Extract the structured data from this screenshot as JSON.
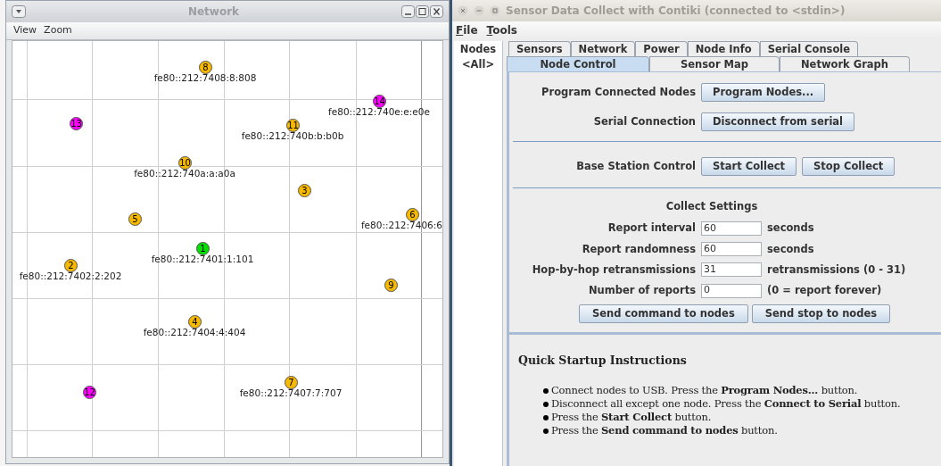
{
  "network_window": {
    "title": "Network",
    "menu": [
      "View",
      "Zoom"
    ],
    "nodes": [
      {
        "label": "8",
        "address": "fe80::212:7408:8:808",
        "color": "#f7b900"
      },
      {
        "label": "14",
        "address": "fe80::212:740e:e:e0e",
        "color": "#ff00ff"
      },
      {
        "label": "13",
        "color": "#ff00ff"
      },
      {
        "label": "11",
        "address": "fe80::212:740b:b:b0b",
        "color": "#f7b900"
      },
      {
        "label": "10",
        "address": "fe80::212:740a:a:a0a",
        "color": "#f7b900"
      },
      {
        "label": "3",
        "color": "#f7b900"
      },
      {
        "label": "5",
        "color": "#f7b900"
      },
      {
        "label": "6",
        "address": "fe80::212:7406:6",
        "color": "#f7b900"
      },
      {
        "label": "1",
        "address": "fe80::212:7401:1:101",
        "color": "#00e000"
      },
      {
        "label": "2",
        "address": "fe80::212:7402:2:202",
        "color": "#f7b900"
      },
      {
        "label": "9",
        "color": "#f7b900"
      },
      {
        "label": "4",
        "address": "fe80::212:7404:4:404",
        "color": "#f7b900"
      },
      {
        "label": "12",
        "color": "#ff00ff"
      },
      {
        "label": "7",
        "address": "fe80::212:7407:7:707",
        "color": "#f7b900"
      }
    ]
  },
  "main_window": {
    "title": "Sensor Data Collect with Contiki (connected to <stdin>)",
    "menu": [
      {
        "mnemonic": "F",
        "rest": "ile"
      },
      {
        "mnemonic": "T",
        "rest": "ools"
      }
    ],
    "nodes_list": {
      "title": "Nodes",
      "items": [
        "<All>"
      ]
    },
    "tabs_row_1": [
      {
        "label": "Sensors",
        "selected": false
      },
      {
        "label": "Network",
        "selected": false
      },
      {
        "label": "Power",
        "selected": false
      },
      {
        "label": "Node Info",
        "selected": false
      },
      {
        "label": "Serial Console",
        "selected": false
      }
    ],
    "tabs_row_2": [
      {
        "label": "Node Control",
        "selected": true
      },
      {
        "label": "Sensor Map",
        "selected": false
      },
      {
        "label": "Network Graph",
        "selected": false
      }
    ],
    "node_control": {
      "program_row": {
        "label": "Program Connected Nodes",
        "buttons": [
          "Program Nodes..."
        ]
      },
      "serial_row": {
        "label": "Serial Connection",
        "buttons": [
          "Disconnect from serial"
        ]
      },
      "base_station_row": {
        "label": "Base Station Control",
        "buttons": [
          "Start Collect",
          "Stop Collect"
        ]
      },
      "collect_settings": {
        "title": "Collect Settings",
        "fields": [
          {
            "label": "Report interval",
            "value": "60",
            "unit": "seconds"
          },
          {
            "label": "Report randomness",
            "value": "60",
            "unit": "seconds"
          },
          {
            "label": "Hop-by-hop retransmissions",
            "value": "31",
            "unit": "retransmissions (0 - 31)"
          },
          {
            "label": "Number of reports",
            "value": "0",
            "unit": "(0 = report forever)"
          }
        ],
        "buttons": [
          "Send command to nodes",
          "Send stop to nodes"
        ]
      },
      "instructions": {
        "title": "Quick Startup Instructions",
        "items": [
          "Connect nodes to USB. Press the **Program Nodes...** button.",
          "Disconnect all except one node. Press the **Connect to Serial** button.",
          "Press the **Start Collect** button.",
          "Press the **Send command to nodes** button."
        ]
      }
    }
  }
}
